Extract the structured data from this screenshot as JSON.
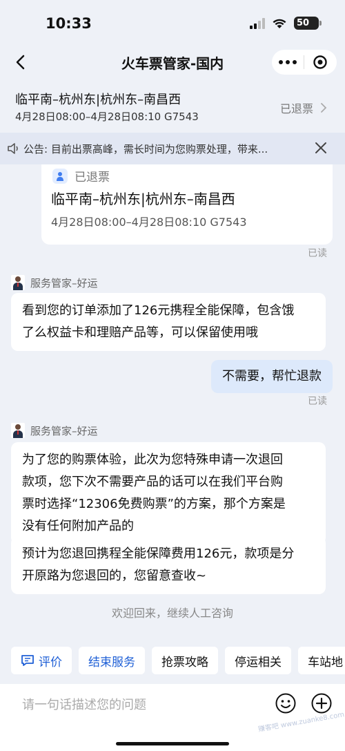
{
  "status_bar": {
    "time": "10:33",
    "battery": "50",
    "battery_level": 0.5
  },
  "nav": {
    "title": "火车票管家-国内"
  },
  "order": {
    "route": "临平南–杭州东|杭州东–南昌西",
    "detail": "4月28日08:00–4月28日08:10 G7543",
    "status": "已退票"
  },
  "notice": {
    "text": "公告: 目前出票高峰，需长时间为您购票处理，带来..."
  },
  "card": {
    "status": "已退票",
    "route": "临平南–杭州东|杭州东–南昌西",
    "detail": "4月28日08:00–4月28日08:10 G7543"
  },
  "messages": {
    "read_1": "已读",
    "agent_1": {
      "name": "服务管家–好运",
      "lines": [
        "看到您的订单添加了126元携程全能保障，包含饿",
        "了么权益卡和理赔产品等，可以保留使用哦"
      ]
    },
    "user_1": {
      "text": "不需要，帮忙退款",
      "read": "已读"
    },
    "agent_2": {
      "name": "服务管家–好运",
      "bubble_1": [
        "为了您的购票体验，此次为您特殊申请一次退回",
        "款项，您下次不需要产品的话可以在我们平台购",
        "票时选择“12306免费购票”的方案，那个方案是",
        "没有任何附加产品的"
      ],
      "bubble_2": [
        "预计为您退回携程全能保障费用126元，款项是分",
        "开原路为您退回的，您留意查收~"
      ]
    },
    "system": "欢迎回来，继续人工咨询"
  },
  "chips": [
    "评价",
    "结束服务",
    "抢票攻略",
    "停运相关",
    "车站地"
  ],
  "input": {
    "placeholder": "请一句话描述您的问题"
  },
  "watermark": "赚客吧 www.zuanke8.com",
  "colors": {
    "accent": "#1e5fd6",
    "background": "#eef1f7",
    "user_bubble": "#dde9fb"
  },
  "icons": [
    "back-chevron-icon",
    "more-dots-icon",
    "target-icon",
    "speaker-icon",
    "close-icon",
    "ticket-icon",
    "emoji-icon",
    "plus-icon",
    "comment-icon"
  ]
}
